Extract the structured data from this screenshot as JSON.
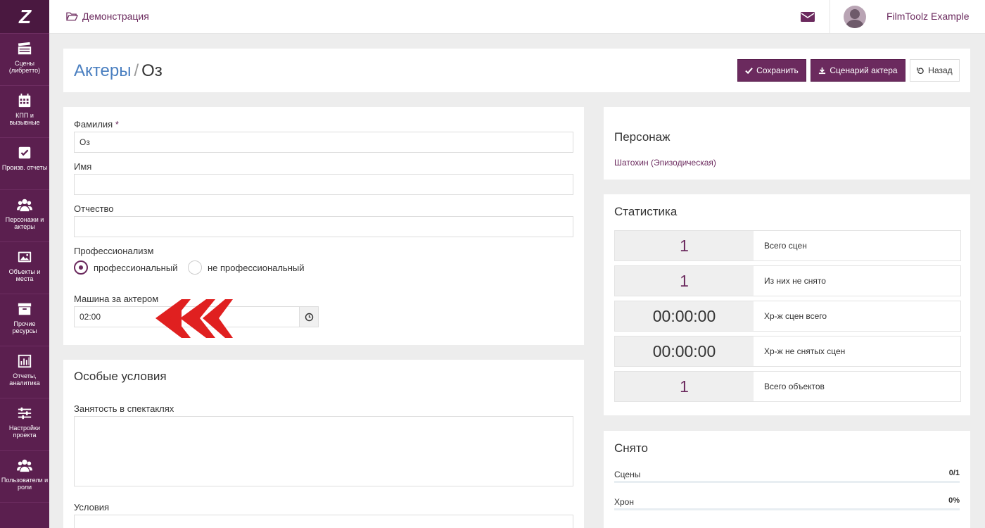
{
  "sidebar": {
    "logo": "Z",
    "items": [
      {
        "label": "Сцены (либретто)",
        "icon": "clapperboard-icon"
      },
      {
        "label": "КПП и вызывные",
        "icon": "calendar-icon"
      },
      {
        "label": "Произв. отчеты",
        "icon": "checkbox-icon"
      },
      {
        "label": "Персонажи и актеры",
        "icon": "users-icon"
      },
      {
        "label": "Объекты и места",
        "icon": "image-icon"
      },
      {
        "label": "Прочие ресурсы",
        "icon": "archive-icon"
      },
      {
        "label": "Отчеты, аналитика",
        "icon": "bar-chart-icon"
      },
      {
        "label": "Настройки проекта",
        "icon": "sliders-icon"
      },
      {
        "label": "Пользователи и роли",
        "icon": "user-group-icon"
      }
    ]
  },
  "topbar": {
    "project": "Демонстрация",
    "user": "FilmToolz Example"
  },
  "header": {
    "breadcrumb_link": "Актеры",
    "breadcrumb_sep": "/",
    "title": "Оз",
    "buttons": {
      "save": "Сохранить",
      "script": "Сценарий актера",
      "back": "Назад"
    }
  },
  "form": {
    "surname_label": "Фамилия",
    "required_mark": "*",
    "surname_value": "Оз",
    "name_label": "Имя",
    "name_value": "",
    "patronymic_label": "Отчество",
    "patronymic_value": "",
    "professionalism_label": "Профессионализм",
    "professionalism_options": [
      "профессиональный",
      "не профессиональный"
    ],
    "professionalism_selected": "профессиональный",
    "car_label": "Машина за актером",
    "car_value": "02:00"
  },
  "special": {
    "title": "Особые условия",
    "theatre_label": "Занятость в спектаклях",
    "conditions_label": "Условия"
  },
  "character": {
    "title": "Персонаж",
    "link": "Шатохин (Эпизодическая)"
  },
  "stats": {
    "title": "Статистика",
    "rows": [
      {
        "value": "1",
        "label": "Всего сцен"
      },
      {
        "value": "1",
        "label": "Из них не снято"
      },
      {
        "value": "00:00:00",
        "label": "Хр-ж сцен всего"
      },
      {
        "value": "00:00:00",
        "label": "Хр-ж не снятых сцен"
      },
      {
        "value": "1",
        "label": "Всего объектов"
      }
    ]
  },
  "shot": {
    "title": "Снято",
    "rows": [
      {
        "label": "Сцены",
        "value": "0/1",
        "progress": 0
      },
      {
        "label": "Хрон",
        "value": "0%",
        "progress": 0
      }
    ]
  },
  "colors": {
    "brand": "#6b2a5e",
    "sidebar": "#5b1f4f",
    "link": "#4a7fc0",
    "arrow": "#e02020"
  }
}
